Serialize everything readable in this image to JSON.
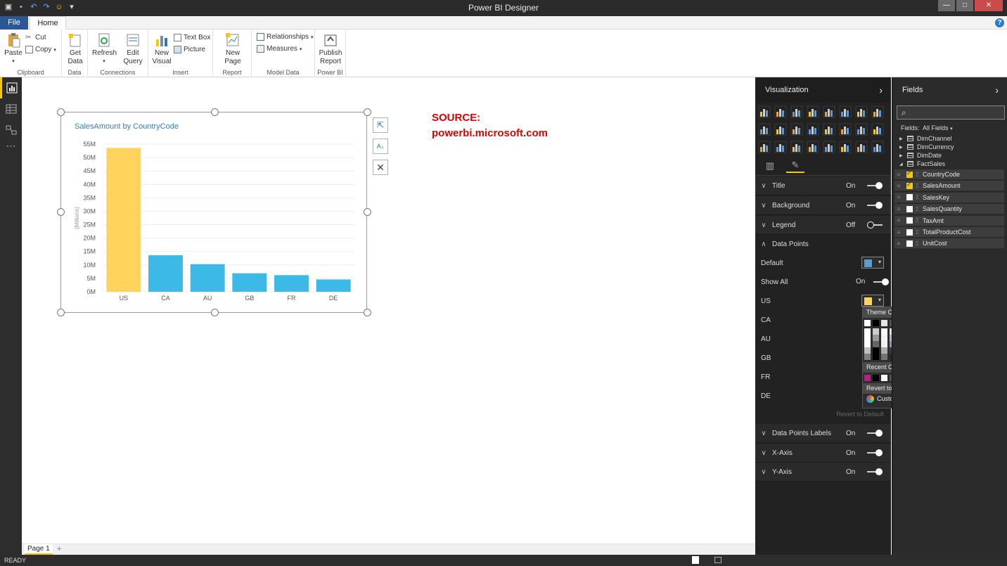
{
  "app": {
    "title": "Power BI Designer"
  },
  "window": {
    "minimize": "—",
    "maximize": "□",
    "close": "✕"
  },
  "tabs": {
    "file": "File",
    "home": "Home"
  },
  "ribbon": {
    "clipboard": {
      "group": "Clipboard",
      "paste": "Paste",
      "cut": "Cut",
      "copy": "Copy"
    },
    "data": {
      "group": "Data",
      "get_data_line1": "Get",
      "get_data_line2": "Data"
    },
    "connections": {
      "group": "Connections",
      "refresh": "Refresh",
      "edit_line1": "Edit",
      "edit_line2": "Query"
    },
    "insert": {
      "group": "Insert",
      "new_visual_line1": "New",
      "new_visual_line2": "Visual",
      "text_box": "Text Box",
      "picture": "Picture"
    },
    "report": {
      "group": "Report",
      "new_page": "New Page"
    },
    "model": {
      "group": "Model Data",
      "relationships": "Relationships",
      "measures": "Measures"
    },
    "powerbi": {
      "group": "Power BI",
      "publish_line1": "Publish",
      "publish_line2": "Report"
    }
  },
  "chart_data": {
    "type": "bar",
    "title": "SalesAmount by CountryCode",
    "ylabel": "(Millions)",
    "xlabel": "",
    "categories": [
      "US",
      "CA",
      "AU",
      "GB",
      "FR",
      "DE"
    ],
    "values": [
      53.6,
      13.6,
      10.3,
      6.9,
      6.2,
      4.6
    ],
    "ylim": [
      0,
      55
    ],
    "yticks": [
      "0M",
      "5M",
      "10M",
      "15M",
      "20M",
      "25M",
      "30M",
      "35M",
      "40M",
      "45M",
      "50M",
      "55M"
    ],
    "grid": true,
    "colors": {
      "highlight": "#FFD35C",
      "default": "#3DB9E8"
    }
  },
  "source": {
    "line1": "SOURCE:",
    "line2": "powerbi.microsoft.com"
  },
  "pages": {
    "tab": "Page 1",
    "add": "+"
  },
  "status": {
    "ready": "READY"
  },
  "viz_pane": {
    "title": "Visualization",
    "sections": {
      "title": {
        "label": "Title",
        "state": "On"
      },
      "background": {
        "label": "Background",
        "state": "On"
      },
      "legend": {
        "label": "Legend",
        "state": "Off"
      },
      "data_points": {
        "label": "Data Points"
      },
      "data_labels": {
        "label": "Data Points Labels",
        "state": "On"
      },
      "x_axis": {
        "label": "X-Axis",
        "state": "On"
      },
      "y_axis": {
        "label": "Y-Axis",
        "state": "On"
      }
    },
    "default_label": "Default",
    "default_color": "#5B9BD5",
    "show_all": {
      "label": "Show All",
      "state": "On"
    },
    "countries": [
      "US",
      "CA",
      "AU",
      "GB",
      "FR",
      "DE"
    ],
    "us_color": "#FFD35C",
    "revert_link": "Revert to Default"
  },
  "color_picker": {
    "theme_colors": "Theme Colors",
    "recent_colors": "Recent Colors",
    "revert": "Revert to default",
    "custom": "Custom Color",
    "top_row": [
      "#FFFFFF",
      "#000000",
      "#E7E6E6",
      "#44546A",
      "#5B9BD5",
      "#ED7D31",
      "#A5A5A5",
      "#FFC000",
      "#4472C4",
      "#70AD47"
    ],
    "recent_row": [
      "#C0198C",
      "#000000",
      "#FFFFFF",
      "#44546A",
      "#5B9BD5",
      "#ED7D31",
      "#A5A5A5",
      "#FFC000",
      "#4472C4",
      "#70AD47"
    ]
  },
  "fields_pane": {
    "title": "Fields",
    "filter_label": "Fields:",
    "filter_value": "All Fields",
    "tables": [
      "DimChannel",
      "DimCurrency",
      "DimDate",
      "FactSales"
    ],
    "fields": [
      {
        "name": "CountryCode",
        "checked": true
      },
      {
        "name": "SalesAmount",
        "checked": true
      },
      {
        "name": "SalesKey",
        "checked": false
      },
      {
        "name": "SalesQuantity",
        "checked": false
      },
      {
        "name": "TaxAmt",
        "checked": false
      },
      {
        "name": "TotalProductCost",
        "checked": false
      },
      {
        "name": "UnitCost",
        "checked": false
      }
    ]
  }
}
